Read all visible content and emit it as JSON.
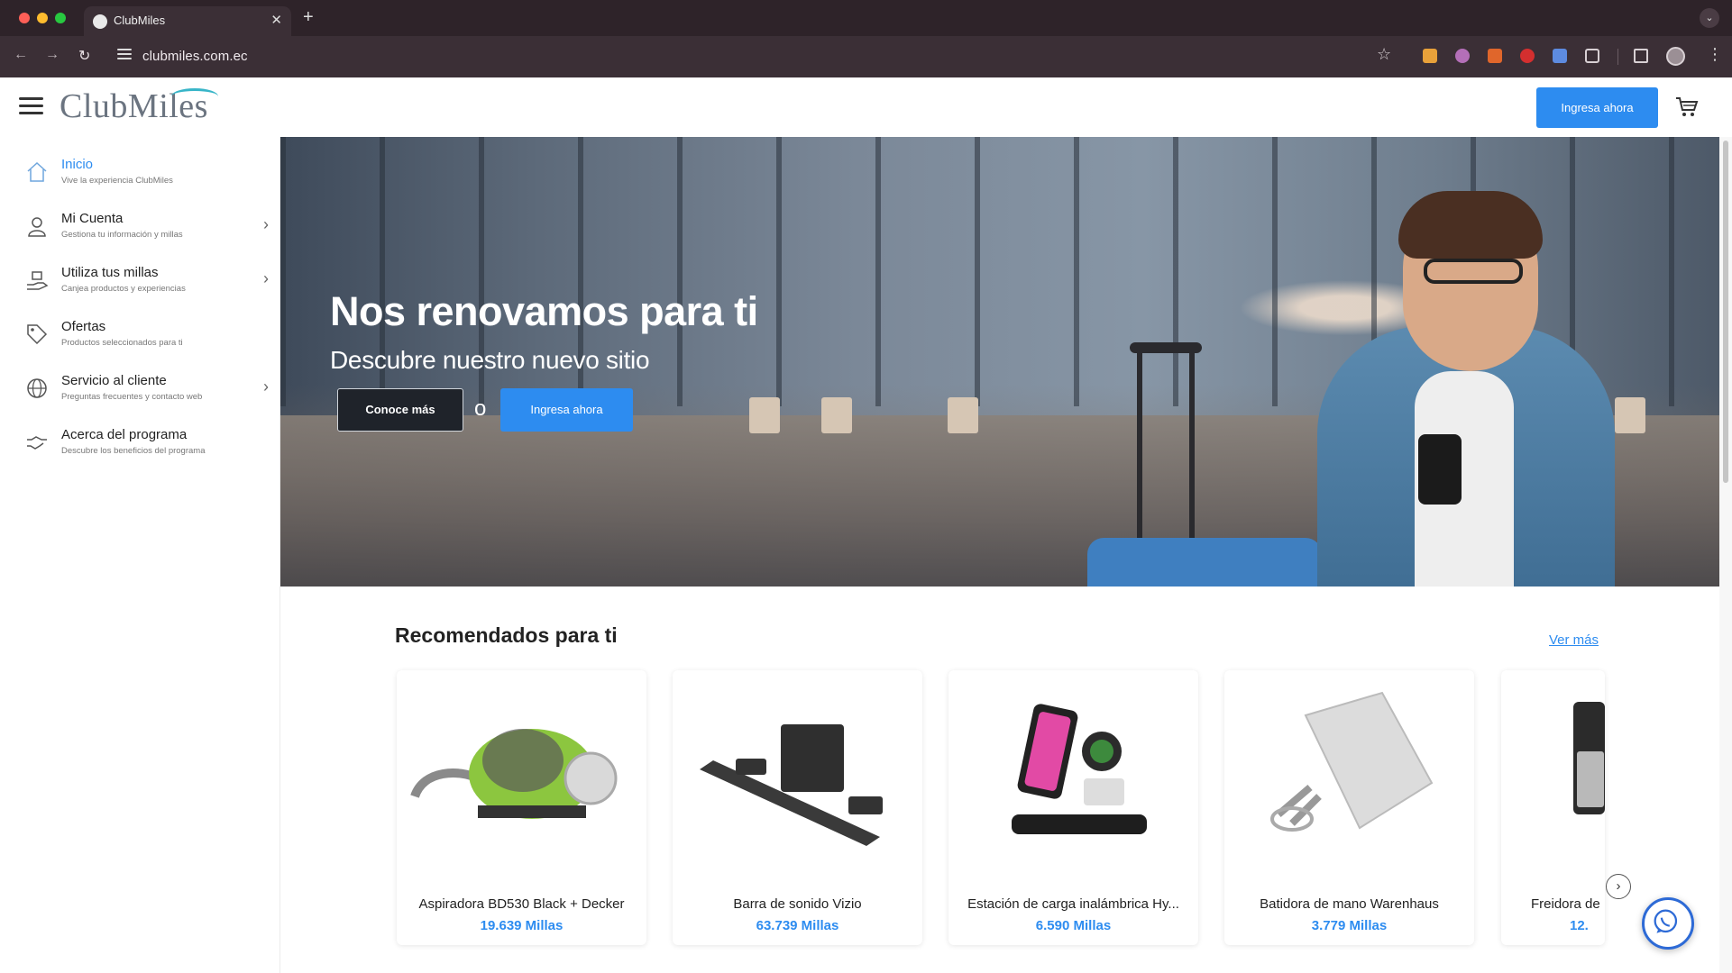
{
  "browser": {
    "tab_title": "ClubMiles",
    "url": "clubmiles.com.ec"
  },
  "header": {
    "logo": "ClubMiles",
    "login_button": "Ingresa ahora"
  },
  "sidebar": {
    "items": [
      {
        "label": "Inicio",
        "sub": "Vive la experiencia ClubMiles",
        "icon": "home-icon",
        "active": true
      },
      {
        "label": "Mi Cuenta",
        "sub": "Gestiona tu información y millas",
        "icon": "user-icon"
      },
      {
        "label": "Utiliza tus millas",
        "sub": "Canjea productos y experiencias",
        "icon": "gift-hand-icon"
      },
      {
        "label": "Ofertas",
        "sub": "Productos seleccionados para ti",
        "icon": "tag-icon"
      },
      {
        "label": "Servicio al cliente",
        "sub": "Preguntas frecuentes y contacto web",
        "icon": "globe-icon"
      },
      {
        "label": "Acerca del programa",
        "sub": "Descubre los beneficios del programa",
        "icon": "handshake-icon"
      }
    ]
  },
  "hero": {
    "title": "Nos renovamos para ti",
    "subtitle": "Descubre nuestro nuevo sitio",
    "primary_button": "Conoce más",
    "separator": "o",
    "secondary_button": "Ingresa ahora"
  },
  "recommended": {
    "title": "Recomendados para ti",
    "see_more": "Ver más",
    "products": [
      {
        "name": "Aspiradora BD530 Black + Decker",
        "price": "19.639 Millas"
      },
      {
        "name": "Barra de sonido Vizio",
        "price": "63.739 Millas"
      },
      {
        "name": "Estación de carga inalámbrica Hy...",
        "price": "6.590 Millas"
      },
      {
        "name": "Batidora de mano Warenhaus",
        "price": "3.779 Millas"
      },
      {
        "name": "Freidora de",
        "price": "12."
      }
    ]
  },
  "colors": {
    "accent": "#2d8cf0",
    "chrome": "#3b2f36"
  }
}
